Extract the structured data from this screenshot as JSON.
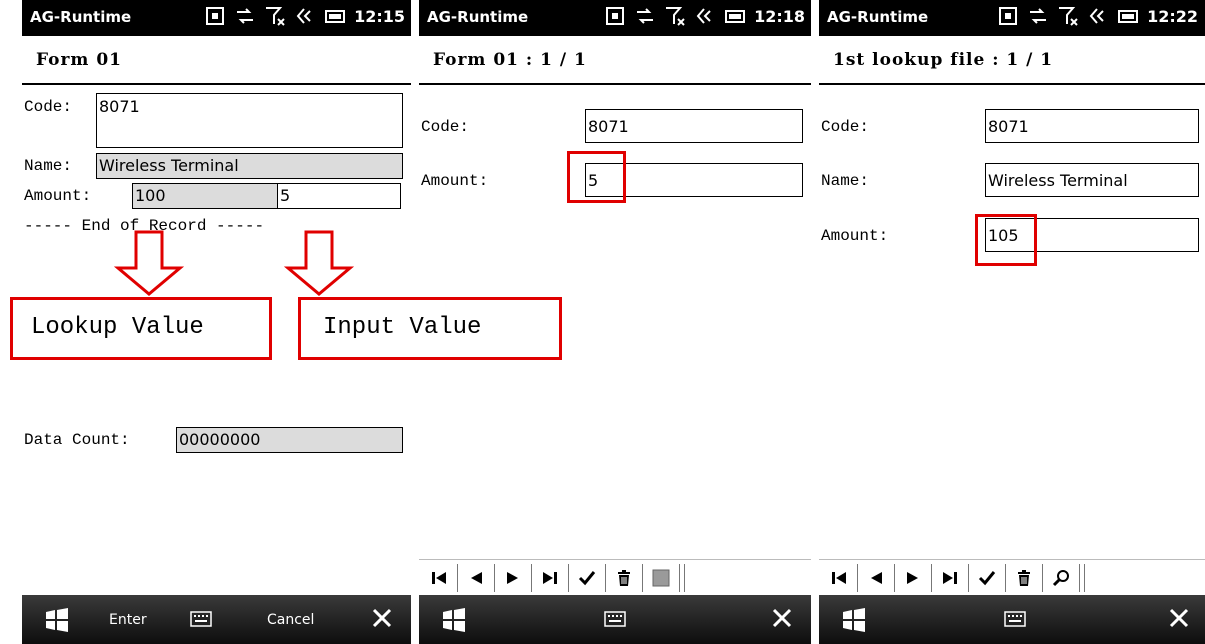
{
  "statusbar": {
    "app_name": "AG-Runtime"
  },
  "screen1": {
    "clock": "12:15",
    "form_title": "Form 01",
    "code_label": "Code:",
    "code_value": "8071",
    "name_label": "Name:",
    "name_value": "Wireless Terminal",
    "amount_label": "Amount:",
    "amount_value": "100",
    "plus_sign": "+",
    "input_value": "5",
    "end_of_record": "----- End of Record -----",
    "callout_lookup": "Lookup Value",
    "callout_input": "Input Value",
    "data_count_label": "Data Count:",
    "data_count_value": "00000000",
    "softkey_left": "Enter",
    "softkey_right": "Cancel"
  },
  "screen2": {
    "clock": "12:18",
    "form_title": "Form 01 : 1 / 1",
    "code_label": "Code:",
    "code_value": "8071",
    "amount_label": "Amount:",
    "amount_value": "5"
  },
  "screen3": {
    "clock": "12:22",
    "form_title": "1st lookup file : 1 / 1",
    "code_label": "Code:",
    "code_value": "8071",
    "name_label": "Name:",
    "name_value": "Wireless Terminal",
    "amount_label": "Amount:",
    "amount_value": "105"
  },
  "colors": {
    "highlight": "#e00000",
    "statusbar": "#000000",
    "readonly_field": "#dcdcdc"
  },
  "icons": [
    "sim-icon",
    "data-transfer-icon",
    "no-signal-icon",
    "speaker-icon",
    "battery-icon",
    "windows-start-icon",
    "keyboard-icon",
    "close-icon",
    "first-record-icon",
    "prev-record-icon",
    "next-record-icon",
    "last-record-icon",
    "confirm-icon",
    "delete-icon",
    "search-icon"
  ]
}
